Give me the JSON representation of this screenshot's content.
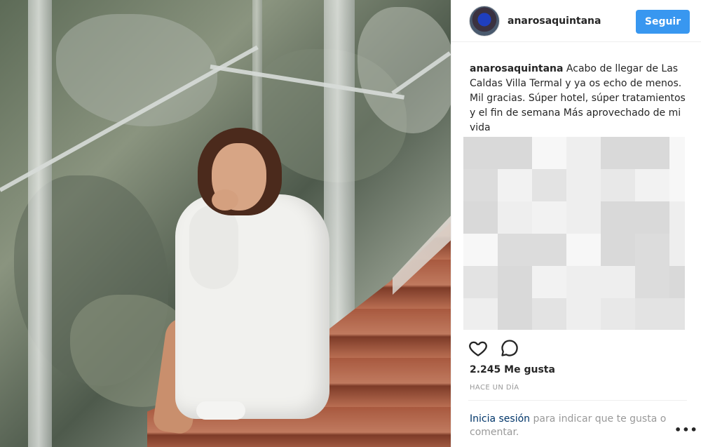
{
  "header": {
    "username": "anarosaquintana",
    "follow_label": "Seguir"
  },
  "caption": {
    "username": "anarosaquintana",
    "text": " Acabo de llegar de Las Caldas Villa Termal y ya os echo de menos. Mil gracias. Súper hotel, súper tratamientos y el fin de semana Más aprovechado de mi vida"
  },
  "actions": {
    "like_icon": "heart-icon",
    "comment_icon": "comment-bubble-icon"
  },
  "likes": "2.245 Me gusta",
  "time": "HACE UN DÍA",
  "login": {
    "link": "Inicia sesión",
    "text": " para indicar que te gusta o comentar."
  },
  "more": "•••",
  "colors": {
    "follow_button": "#3897f0",
    "link": "#003569",
    "muted": "#999999",
    "text": "#262626"
  }
}
